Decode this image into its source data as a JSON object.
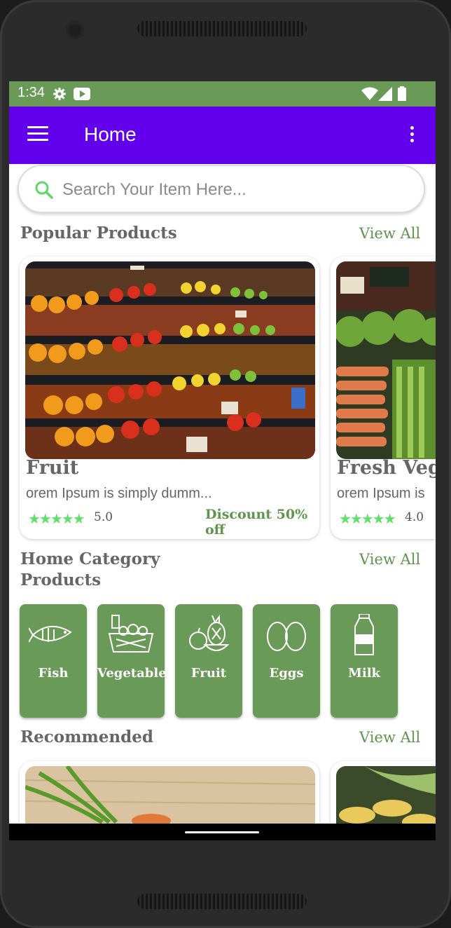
{
  "status_bar": {
    "time": "1:34",
    "color": "#699a58"
  },
  "app_bar": {
    "title": "Home",
    "color": "#6200ee"
  },
  "search": {
    "placeholder": "Search Your Item Here..."
  },
  "popular": {
    "title": "Popular Products",
    "view_all": "View All",
    "items": [
      {
        "name": "Fruit",
        "desc": "orem Ipsum is simply dumm...",
        "stars": "★★★★★",
        "rating": "5.0",
        "discount": "Discount 50% off"
      },
      {
        "name": "Fresh Veget",
        "desc": "orem Ipsum is",
        "stars": "★★★★★",
        "rating": "4.0"
      }
    ]
  },
  "categories": {
    "title_line1": "Home Category",
    "title_line2": "Products",
    "view_all": "View All",
    "items": [
      {
        "label": "Fish",
        "icon": "fish-icon"
      },
      {
        "label": "Vegetable",
        "icon": "vegetable-icon"
      },
      {
        "label": "Fruit",
        "icon": "fruit-icon"
      },
      {
        "label": "Eggs",
        "icon": "eggs-icon"
      },
      {
        "label": "Milk",
        "icon": "milk-icon"
      }
    ]
  },
  "recommended": {
    "title": "Recommended",
    "view_all": "View All"
  },
  "theme": {
    "accent_green": "#5e944d",
    "category_green": "#699a58",
    "star_green": "#5fe06a"
  }
}
